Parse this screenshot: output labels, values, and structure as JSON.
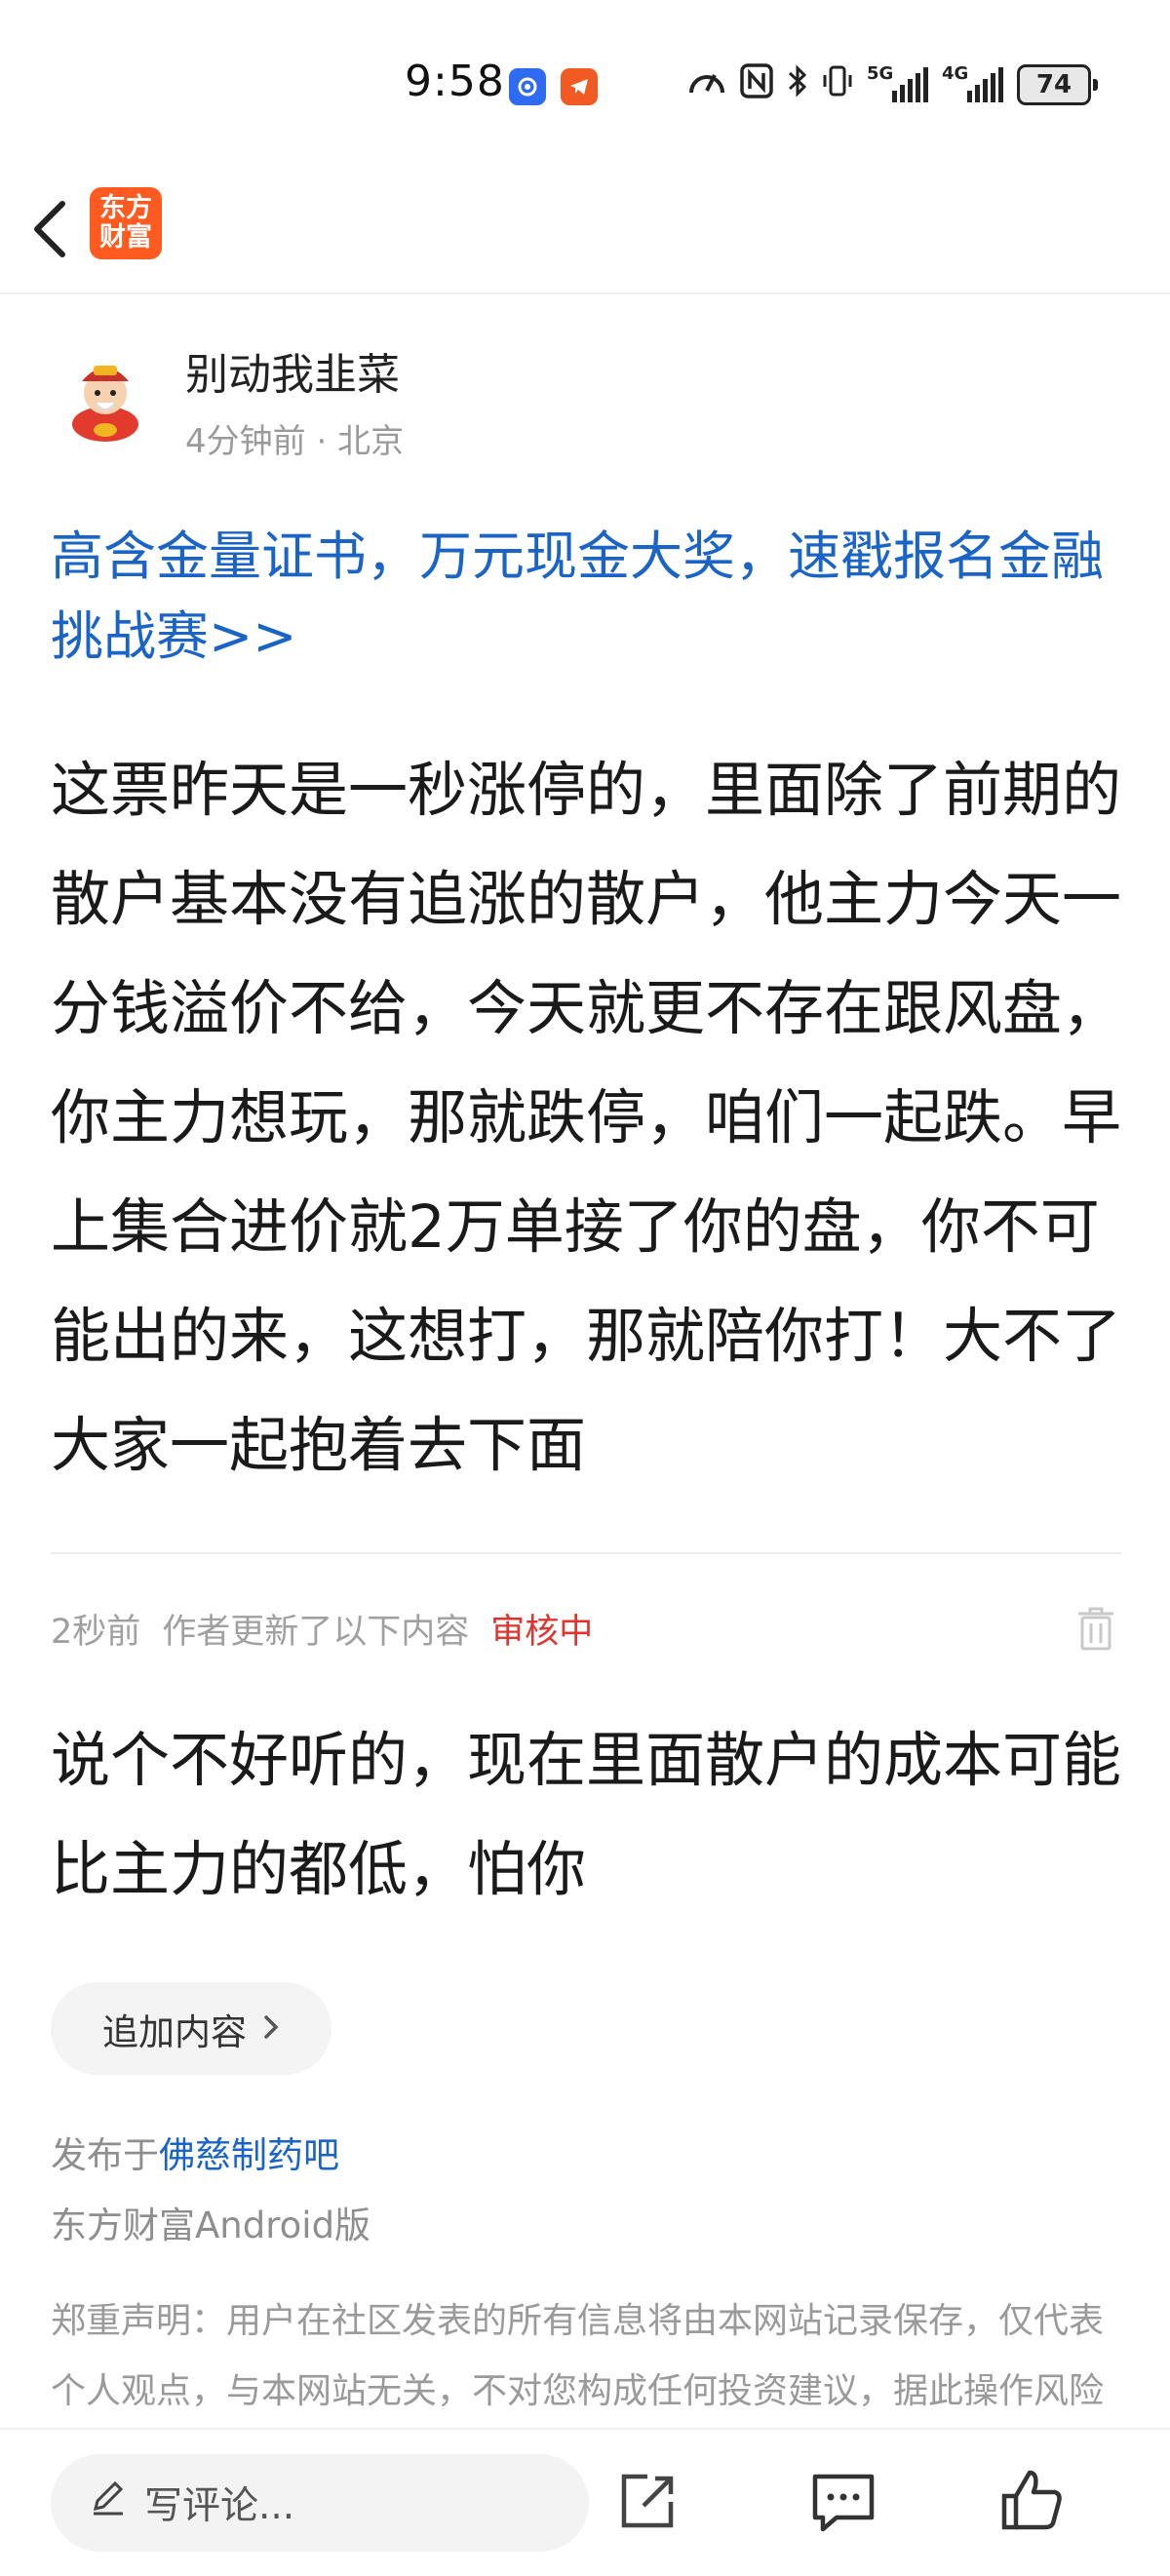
{
  "status": {
    "time": "9:58",
    "signal_5g": "5G",
    "signal_4g": "4G",
    "battery": "74"
  },
  "nav": {
    "logo_line1": "东方",
    "logo_line2": "财富"
  },
  "post": {
    "author": "别动我韭菜",
    "time_ago": "4分钟前",
    "location": "北京",
    "promo": "高含金量证书，万元现金大奖，速戳报名金融挑战赛>>",
    "body": "这票昨天是一秒涨停的，里面除了前期的散户基本没有追涨的散户，他主力今天一分钱溢价不给，今天就更不存在跟风盘，你主力想玩，那就跌停，咱们一起跌。早上集合进价就2万单接了你的盘，你不可能出的来，这想打，那就陪你打！大不了大家一起抱着去下面"
  },
  "update": {
    "time_ago": "2秒前",
    "label": "作者更新了以下内容",
    "status": "审核中",
    "body": "说个不好听的，现在里面散户的成本可能比主力的都低，怕你"
  },
  "add_button": "追加内容",
  "published": {
    "prefix": "发布于",
    "bar": "佛慈制药吧",
    "client": "东方财富Android版"
  },
  "disclaimer": "郑重声明：用户在社区发表的所有信息将由本网站记录保存，仅代表个人观点，与本网站无关，不对您构成任何投资建议，据此操作风险自担。请勿相信代客理财、免费荐股和炒股培训等宣传内容，远离非法证券活动。",
  "bottom": {
    "comment_placeholder": "写评论..."
  },
  "colors": {
    "link": "#1a64c8",
    "status_red": "#e0342e",
    "brand_orange": "#ff5a1f"
  },
  "icons": [
    "back-arrow-icon",
    "app-logo",
    "trash-icon",
    "chevron-right-icon",
    "pencil-icon",
    "share-icon",
    "comment-icon",
    "thumbs-up-icon"
  ]
}
